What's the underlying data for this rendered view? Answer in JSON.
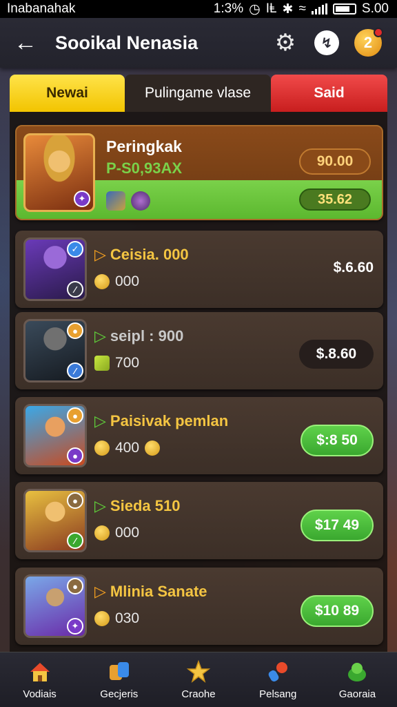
{
  "status_bar": {
    "carrier": "Inabanahak",
    "time": "1:3%",
    "signal_text": "IⱠ",
    "battery_text": "S.00"
  },
  "header": {
    "back_label": "←",
    "title": "Sooikal Nenasia"
  },
  "tabs": [
    {
      "label": "Newai"
    },
    {
      "label": "Pulingame vlase"
    },
    {
      "label": "Said"
    }
  ],
  "featured": {
    "name": "Peringkak",
    "sub": "P-S0,93AX",
    "price": "90.00",
    "price_secondary": "35.62"
  },
  "items": [
    {
      "name": "Ceisia. 000",
      "coins": "000",
      "price": "$.6.60"
    },
    {
      "name": "seipl : 900",
      "coins": "700",
      "price": "$.8.60"
    },
    {
      "name": "Paisivak pemlan",
      "coins": "400",
      "price": "$:8 50"
    },
    {
      "name": "Sieda 510",
      "coins": "000",
      "price": "$17 49"
    },
    {
      "name": "Mlinia Sanate",
      "coins": "030",
      "price": "$10 89"
    }
  ],
  "bottom_nav": [
    {
      "label": "Vodiais",
      "icon": "home-icon"
    },
    {
      "label": "Gecjeris",
      "icon": "gems-icon"
    },
    {
      "label": "Craohe",
      "icon": "star-icon"
    },
    {
      "label": "Pelsang",
      "icon": "potion-icon"
    },
    {
      "label": "Gaoraia",
      "icon": "bag-icon"
    }
  ],
  "colors": {
    "accent_yellow": "#f2c400",
    "accent_red": "#c81e1e",
    "accent_green": "#3aa82f",
    "gold_text": "#f4c542"
  }
}
